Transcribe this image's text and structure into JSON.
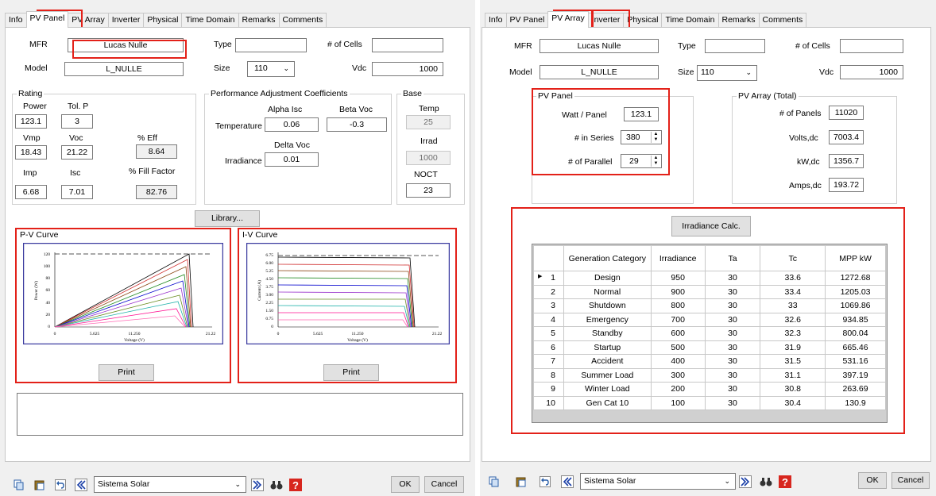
{
  "left": {
    "tabs": [
      "Info",
      "PV Panel",
      "PV Array",
      "Inverter",
      "Physical",
      "Time Domain",
      "Remarks",
      "Comments"
    ],
    "active_tab": 1,
    "mfr_label": "MFR",
    "mfr_value": "Lucas Nulle",
    "type_label": "Type",
    "type_value": "",
    "cells_label": "# of Cells",
    "cells_value": "",
    "model_label": "Model",
    "model_value": "L_NULLE",
    "size_label": "Size",
    "size_value": "110",
    "vdc_label": "Vdc",
    "vdc_value": "1000",
    "rating": {
      "title": "Rating",
      "power_label": "Power",
      "power": "123.1",
      "tolp_label": "Tol. P",
      "tolp": "3",
      "vmp_label": "Vmp",
      "vmp": "18.43",
      "voc_label": "Voc",
      "voc": "21.22",
      "eff_label": "% Eff",
      "eff": "8.64",
      "imp_label": "Imp",
      "imp": "6.68",
      "isc_label": "Isc",
      "isc": "7.01",
      "ff_label": "% Fill Factor",
      "ff": "82.76"
    },
    "perf": {
      "title": "Performance Adjustment Coefficients",
      "alpha_label": "Alpha Isc",
      "beta_label": "Beta Voc",
      "temp_label": "Temperature",
      "alpha": "0.06",
      "beta": "-0.3",
      "delta_label": "Delta Voc",
      "irr_label": "Irradiance",
      "delta": "0.01"
    },
    "base": {
      "title": "Base",
      "temp_label": "Temp",
      "temp": "25",
      "irrad_label": "Irrad",
      "irrad": "1000",
      "noct_label": "NOCT",
      "noct": "23"
    },
    "library_label": "Library...",
    "pv_curve": {
      "title": "P-V Curve",
      "ylabel": "Power (W)",
      "xlabel": "Voltage (V)",
      "yticks": [
        "120",
        "100",
        "80",
        "60",
        "40",
        "20",
        "0"
      ],
      "xticks": [
        "0",
        "5.625",
        "11.250",
        "21.22"
      ],
      "print_label": "Print"
    },
    "iv_curve": {
      "title": "I-V Curve",
      "ylabel": "Current (A)",
      "xlabel": "Voltage (V)",
      "yticks": [
        "6.75",
        "6.00",
        "5.25",
        "4.50",
        "3.75",
        "3.00",
        "2.25",
        "1.50",
        "0.75",
        "0"
      ],
      "xticks": [
        "0",
        "5.625",
        "11.250",
        "21.22"
      ],
      "print_label": "Print"
    },
    "footer": {
      "dropdown": "Sistema Solar",
      "ok": "OK",
      "cancel": "Cancel"
    }
  },
  "right": {
    "tabs": [
      "Info",
      "PV Panel",
      "PV Array",
      "Inverter",
      "Physical",
      "Time Domain",
      "Remarks",
      "Comments"
    ],
    "active_tab": 2,
    "mfr_label": "MFR",
    "mfr_value": "Lucas Nulle",
    "type_label": "Type",
    "type_value": "",
    "cells_label": "# of Cells",
    "cells_value": "",
    "model_label": "Model",
    "model_value": "L_NULLE",
    "size_label": "Size",
    "size_value": "110",
    "vdc_label": "Vdc",
    "vdc_value": "1000",
    "pv_panel": {
      "title": "PV Panel",
      "watt_label": "Watt / Panel",
      "watt": "123.1",
      "series_label": "# in Series",
      "series": "380",
      "parallel_label": "# of Parallel",
      "parallel": "29"
    },
    "pv_array": {
      "title": "PV Array (Total)",
      "panels_label": "# of Panels",
      "panels": "11020",
      "volts_label": "Volts,dc",
      "volts": "7003.4",
      "kw_label": "kW,dc",
      "kw": "1356.7",
      "amps_label": "Amps,dc",
      "amps": "193.72"
    },
    "irr_button": "Irradiance Calc.",
    "table": {
      "headers": [
        "",
        "Generation Category",
        "Irradiance",
        "Ta",
        "Tc",
        "MPP kW"
      ],
      "rows": [
        [
          "1",
          "Design",
          "950",
          "30",
          "33.6",
          "1272.68"
        ],
        [
          "2",
          "Normal",
          "900",
          "30",
          "33.4",
          "1205.03"
        ],
        [
          "3",
          "Shutdown",
          "800",
          "30",
          "33",
          "1069.86"
        ],
        [
          "4",
          "Emergency",
          "700",
          "30",
          "32.6",
          "934.85"
        ],
        [
          "5",
          "Standby",
          "600",
          "30",
          "32.3",
          "800.04"
        ],
        [
          "6",
          "Startup",
          "500",
          "30",
          "31.9",
          "665.46"
        ],
        [
          "7",
          "Accident",
          "400",
          "30",
          "31.5",
          "531.16"
        ],
        [
          "8",
          "Summer Load",
          "300",
          "30",
          "31.1",
          "397.19"
        ],
        [
          "9",
          "Winter Load",
          "200",
          "30",
          "30.8",
          "263.69"
        ],
        [
          "10",
          "Gen Cat 10",
          "100",
          "30",
          "30.4",
          "130.9"
        ]
      ]
    },
    "footer": {
      "dropdown": "Sistema Solar",
      "ok": "OK",
      "cancel": "Cancel"
    }
  }
}
